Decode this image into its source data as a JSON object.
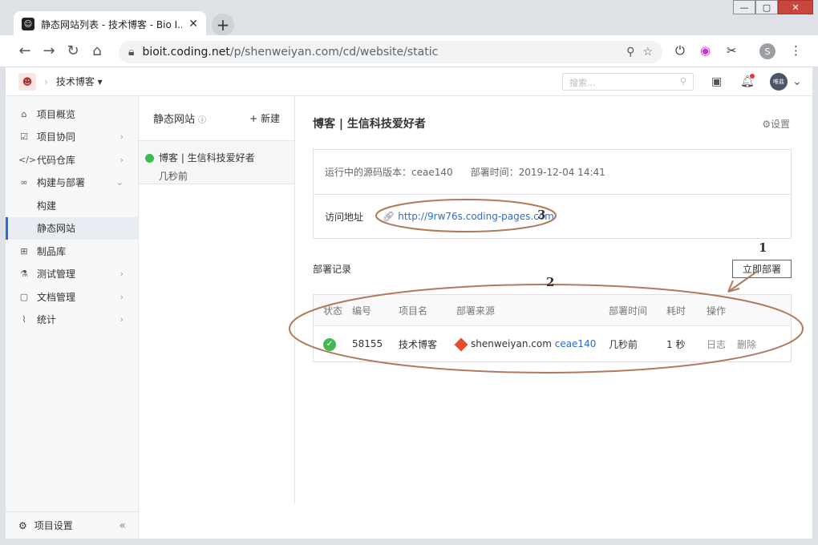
{
  "tab": {
    "title": "静态网站列表 - 技术博客 - Bio I..."
  },
  "url": {
    "host": "bioit.coding.net",
    "path": "/p/shenweiyan.com/cd/website/static"
  },
  "profile_initial": "S",
  "header": {
    "project": "技术博客",
    "search_placeholder": "搜索...",
    "user": "唯盐"
  },
  "sidebar": {
    "items": [
      {
        "icon": "⌂",
        "label": "项目概览",
        "arrow": ""
      },
      {
        "icon": "☑",
        "label": "项目协同",
        "arrow": "›"
      },
      {
        "icon": "</>",
        "label": "代码仓库",
        "arrow": "›"
      },
      {
        "icon": "∞",
        "label": "构建与部署",
        "arrow": "⌄"
      },
      {
        "icon": "",
        "label": "构建",
        "arrow": ""
      },
      {
        "icon": "",
        "label": "静态网站",
        "arrow": ""
      },
      {
        "icon": "⊞",
        "label": "制品库",
        "arrow": ""
      },
      {
        "icon": "⚗",
        "label": "测试管理",
        "arrow": "›"
      },
      {
        "icon": "▢",
        "label": "文档管理",
        "arrow": "›"
      },
      {
        "icon": "⌇",
        "label": "统计",
        "arrow": "›"
      }
    ],
    "footer": "项目设置",
    "collapse": "«"
  },
  "sites": {
    "heading": "静态网站",
    "new_label": "+ 新建",
    "item_name": "博客 | 生信科技爱好者",
    "item_time": "几秒前"
  },
  "main": {
    "title": "博客 | 生信科技爱好者",
    "settings": "⚙设置",
    "version_label": "运行中的源码版本：ceae140",
    "deploy_time_label": "部署时间：2019-12-04 14:41",
    "visit_label": "访问地址",
    "visit_url": "http://9rw76s.coding-pages.com",
    "records_title": "部署记录",
    "deploy_button": "立即部署",
    "table_headers": [
      "状态",
      "编号",
      "项目名",
      "部署来源",
      "部署时间",
      "耗时",
      "操作"
    ],
    "row": {
      "id": "58155",
      "project": "技术博客",
      "source": "shenweiyan.com",
      "commit": "ceae140",
      "time": "几秒前",
      "duration": "1 秒",
      "log": "日志",
      "delete": "删除"
    }
  },
  "annotations": [
    "1",
    "2",
    "3"
  ]
}
